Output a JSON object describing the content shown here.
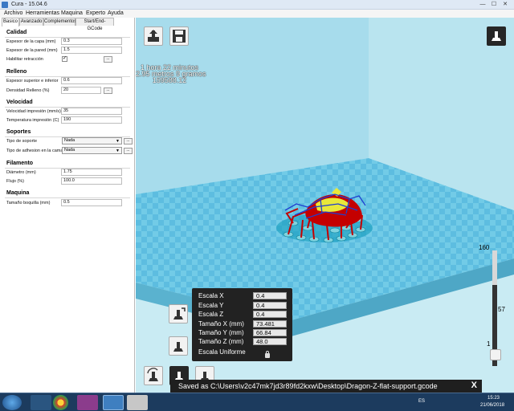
{
  "window": {
    "title": "Cura - 15.04.6",
    "minimize": "—",
    "maximize": "☐",
    "close": "✕"
  },
  "menu": [
    "Archivo",
    "Herramientas",
    "Maquina",
    "Experto",
    "Ayuda"
  ],
  "tabs": [
    "Basico",
    "Avanzado",
    "Complementos",
    "Start/End-GCode"
  ],
  "settings": {
    "calidad": {
      "title": "Calidad",
      "layer_label": "Espesor de la capa (mm)",
      "layer_value": "0.3",
      "wall_label": "Espesor de la pared (mm)",
      "wall_value": "1.5",
      "retract_label": "Habilitar retracción",
      "retract_check": "✓",
      "dots": "..."
    },
    "relleno": {
      "title": "Relleno",
      "topbottom_label": "Espesor superior e inferior",
      "topbottom_value": "0.6",
      "density_label": "Densidad Relleno (%)",
      "density_value": "20",
      "dots": "..."
    },
    "velocidad": {
      "title": "Velocidad",
      "speed_label": "Velocidad impresión (mm/s)",
      "speed_value": "35",
      "temp_label": "Temperatura impresión (C)",
      "temp_value": "190"
    },
    "soportes": {
      "title": "Soportes",
      "support_label": "Tipo de soporte",
      "support_value": "Nada",
      "adhesion_label": "Tipo de adhesion en la cama",
      "adhesion_value": "Nada",
      "arrow": "▼",
      "dots": "..."
    },
    "filamento": {
      "title": "Filamento",
      "diameter_label": "Diámetro (mm)",
      "diameter_value": "1.75",
      "flow_label": "Flujo (%)",
      "flow_value": "100.0"
    },
    "maquina": {
      "title": "Maquina",
      "nozzle_label": "Tamaño boquilla (mm)",
      "nozzle_value": "0.5"
    }
  },
  "print_info": {
    "line1": "1 hora 22 minutos",
    "line2": "2.95 metros 9 gramos",
    "line3": "159588.12"
  },
  "scale_panel": {
    "scale_x_label": "Escala X",
    "scale_x": "0.4",
    "scale_y_label": "Escala Y",
    "scale_y": "0.4",
    "scale_z_label": "Escala Z",
    "scale_z": "0.4",
    "size_x_label": "Tamaño X (mm)",
    "size_x": "73.481",
    "size_y_label": "Tamaño Y (mm)",
    "size_y": "66.84",
    "size_z_label": "Tamaño Z (mm)",
    "size_z": "48.0",
    "uniform_label": "Escala Uniforme"
  },
  "layer_slider": {
    "max": "160",
    "current": "57",
    "min": "1"
  },
  "status": {
    "text": "Saved as C:\\Users\\v2c47mk7jd3r89fd2kxw\\Desktop\\Dragon-Z-flat-support.gcode",
    "close": "X"
  },
  "taskbar": {
    "lang": "ES",
    "time": "15:23",
    "date": "21/06/2018"
  },
  "colors": {
    "floor": "#6fc9e6",
    "wall": "#aee1ee",
    "model": "#c40000",
    "support": "#1f3fd0",
    "infill": "#e8e83a"
  }
}
